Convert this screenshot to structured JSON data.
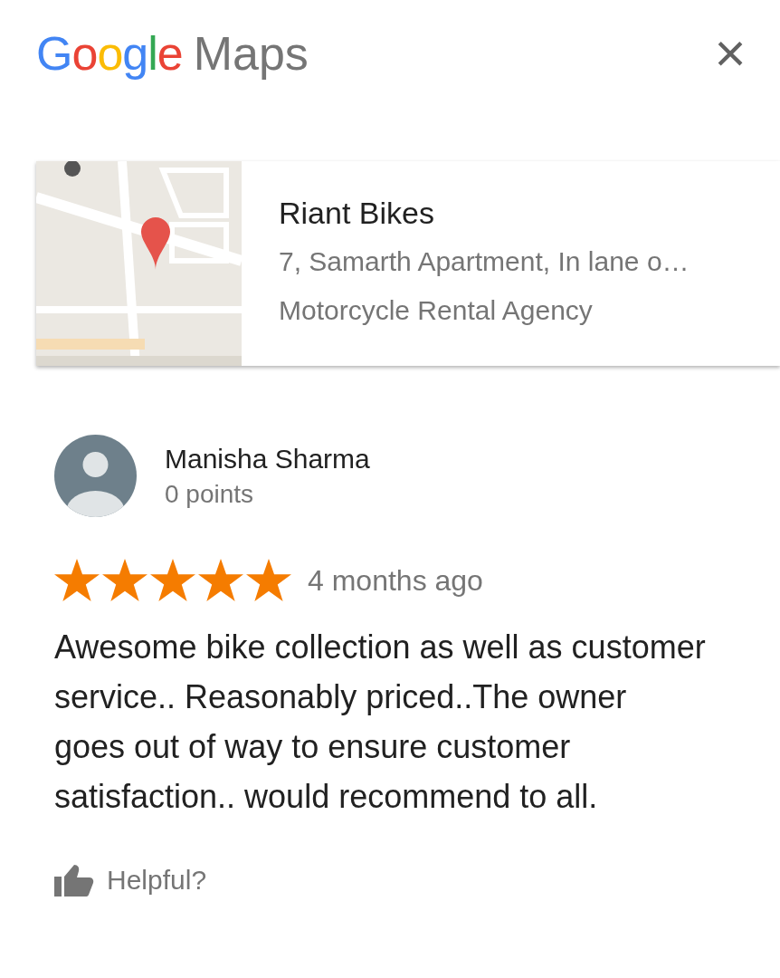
{
  "header": {
    "logo_word_1": "Google",
    "logo_word_2": "Maps",
    "close": "×"
  },
  "place": {
    "name": "Riant Bikes",
    "address": "7, Samarth Apartment, In lane o…",
    "category": "Motorcycle Rental Agency"
  },
  "review": {
    "author": "Manisha Sharma",
    "points": "0 points",
    "stars": 5,
    "time": "4 months ago",
    "text": "Awesome bike collection as well as customer service.. Reasonably priced..The owner goes out of way to ensure customer satisfaction.. would recommend to all.",
    "helpful": "Helpful?"
  }
}
